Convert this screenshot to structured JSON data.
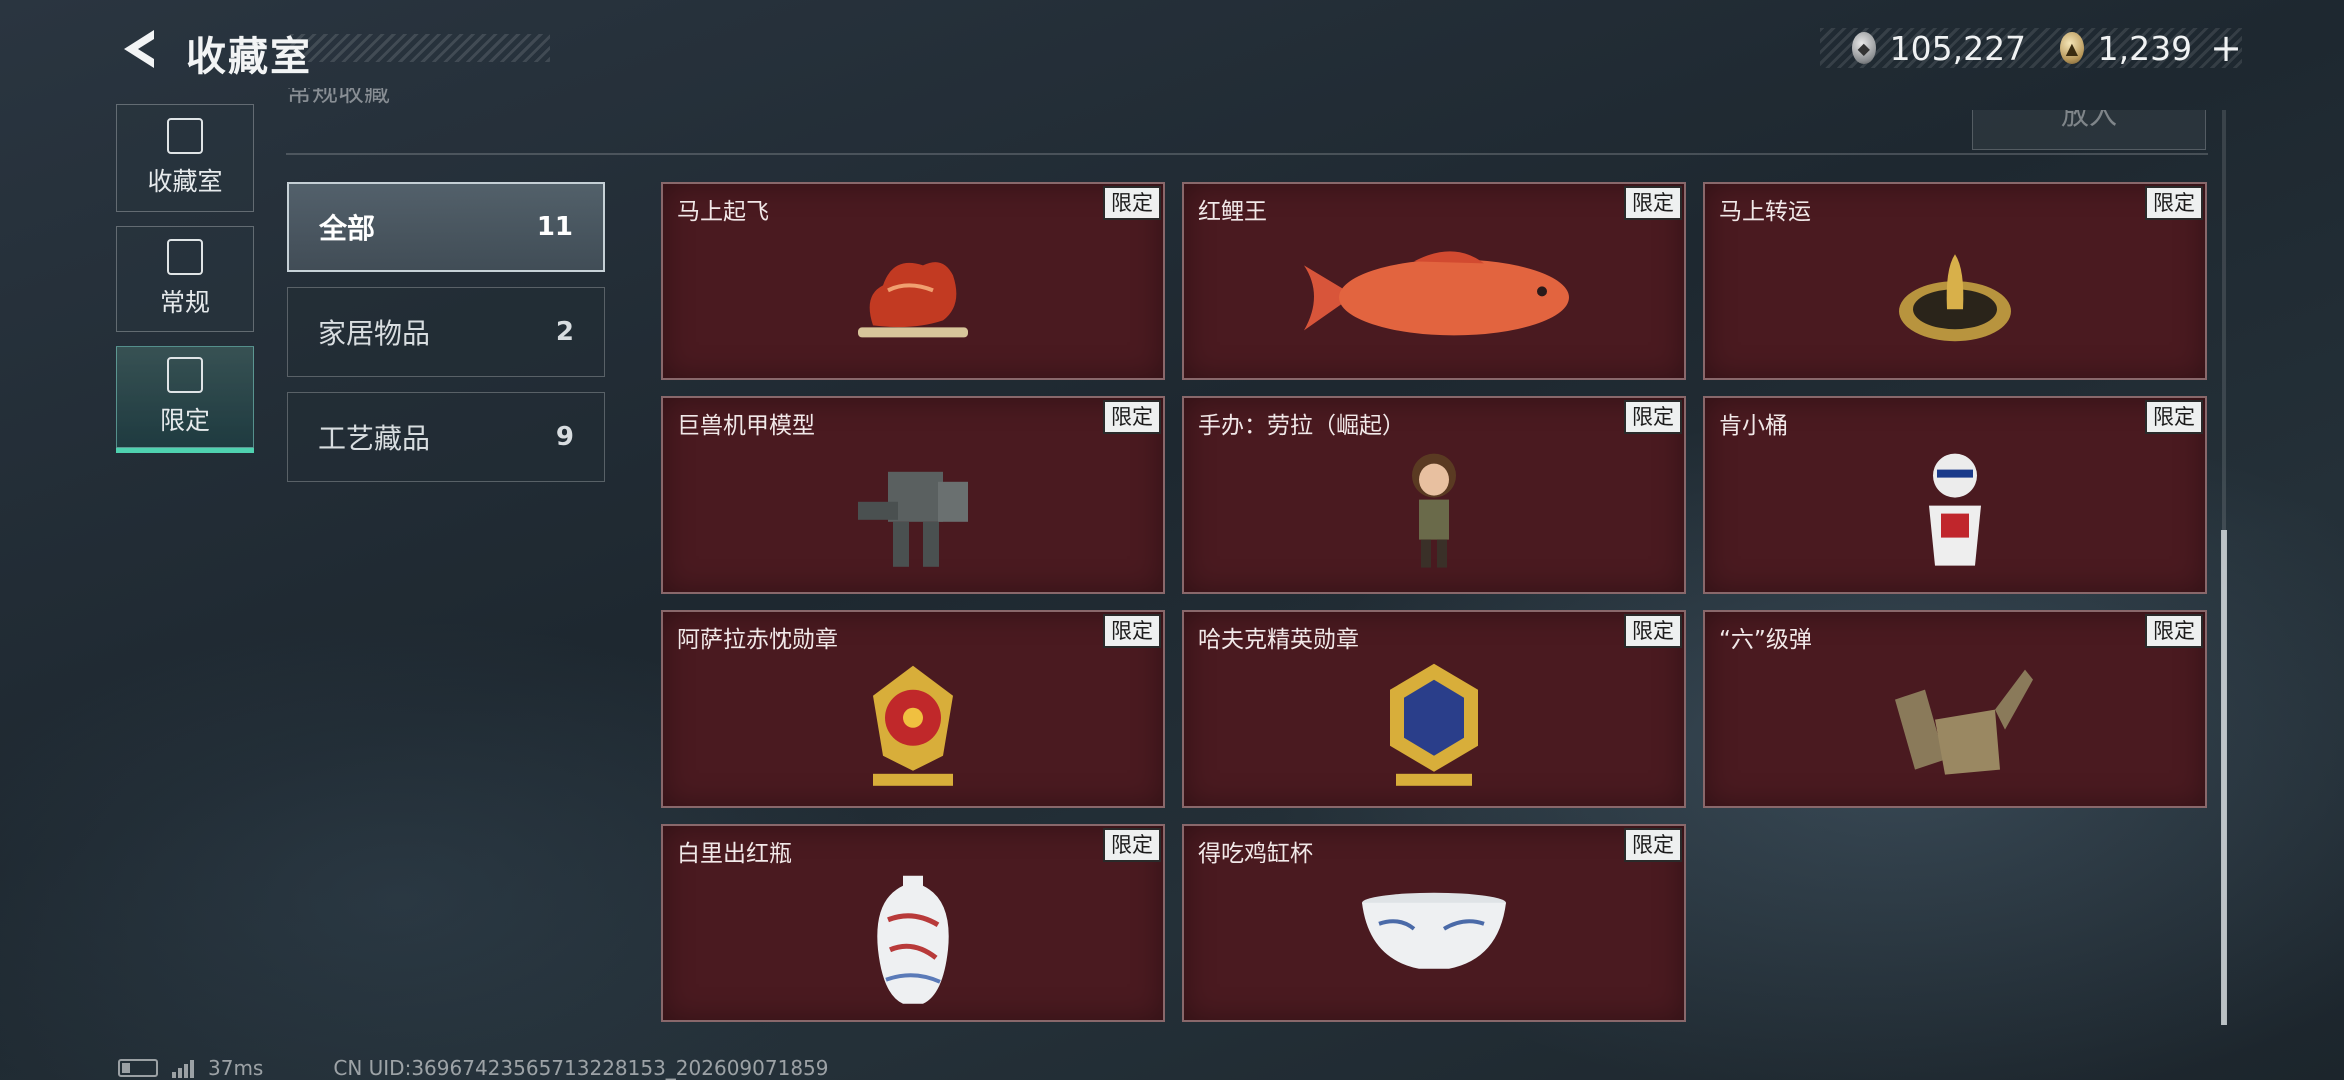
{
  "header": {
    "title": "收藏室",
    "currency": [
      {
        "icon": "silver-coin-icon",
        "value": "105,227"
      },
      {
        "icon": "gold-coin-icon",
        "value": "1,239"
      }
    ],
    "plus_label": "+"
  },
  "side_tabs": [
    {
      "label": "收藏室",
      "icon": "collection-icon",
      "active": false
    },
    {
      "label": "常规",
      "icon": "regular-icon",
      "active": false
    },
    {
      "label": "限定",
      "icon": "limited-icon",
      "active": true
    }
  ],
  "top_faint_text": "常规收藏",
  "put_button_label": "放入",
  "categories": [
    {
      "name": "全部",
      "count": "11",
      "active": true
    },
    {
      "name": "家居物品",
      "count": "2",
      "active": false
    },
    {
      "name": "工艺藏品",
      "count": "9",
      "active": false
    }
  ],
  "badge_label": "限定",
  "items": [
    {
      "name": "马上起飞",
      "art": "horse"
    },
    {
      "name": "红鲤王",
      "art": "carp"
    },
    {
      "name": "马上转运",
      "art": "wheel"
    },
    {
      "name": "巨兽机甲模型",
      "art": "mech"
    },
    {
      "name": "手办：劳拉（崛起）",
      "art": "figure"
    },
    {
      "name": "肯小桶",
      "art": "bucket"
    },
    {
      "name": "阿萨拉赤忱勋章",
      "art": "medal-red"
    },
    {
      "name": "哈夫克精英勋章",
      "art": "medal-blue"
    },
    {
      "name": "“六”级弹",
      "art": "hand"
    },
    {
      "name": "白里出红瓶",
      "art": "vase"
    },
    {
      "name": "得吃鸡缸杯",
      "art": "cup"
    }
  ],
  "status": {
    "ping": "37ms",
    "uid": "CN UID:36967423565713228153_202609071859"
  },
  "colors": {
    "card_bg": "#4a1a20",
    "active_tab_accent": "#4fd2b0"
  }
}
